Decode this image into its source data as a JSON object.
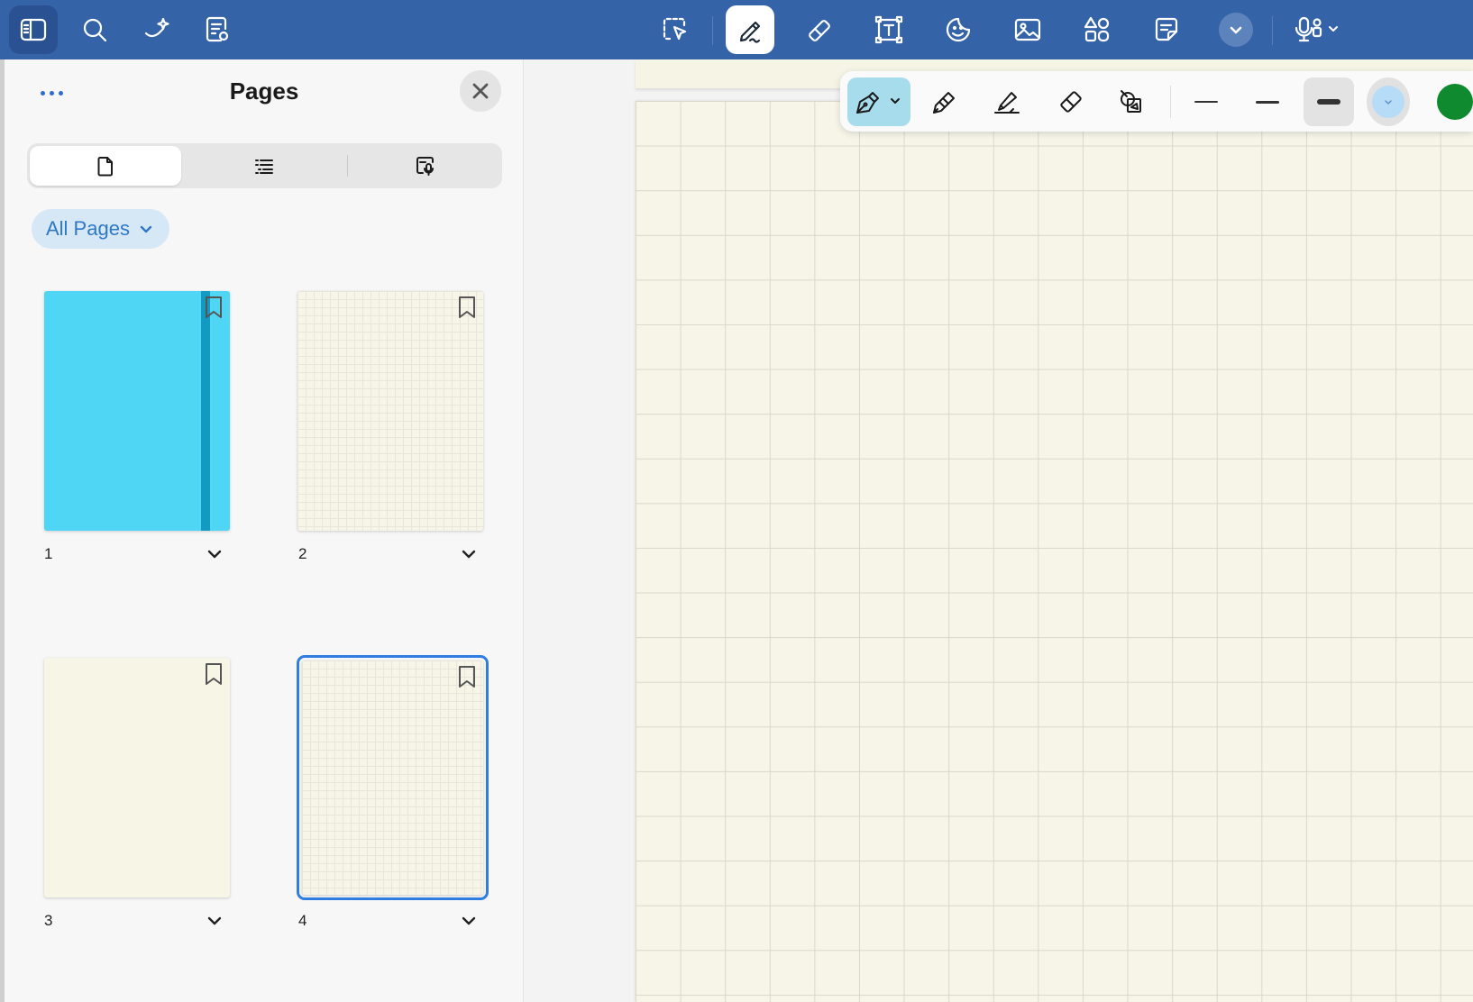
{
  "toolbar": {
    "left_tools": [
      "sidebar-toggle",
      "search",
      "ai-sparkle",
      "note-view"
    ],
    "center_tools": [
      "lasso-select",
      "pen",
      "eraser",
      "text-box",
      "sticker",
      "image",
      "shapes",
      "sticky-note",
      "more"
    ],
    "active_tool": "pen"
  },
  "sidebar": {
    "title": "Pages",
    "tabs": [
      "pages",
      "outline",
      "audio"
    ],
    "active_tab": "pages",
    "filter_label": "All Pages",
    "pages": [
      {
        "number": "1",
        "style": "cover",
        "cover_color": "#4fd6f4",
        "band_color": "#129ac2"
      },
      {
        "number": "2",
        "style": "grid-paper"
      },
      {
        "number": "3",
        "style": "plain-paper"
      },
      {
        "number": "4",
        "style": "grid-paper",
        "selected": true
      }
    ]
  },
  "pen_toolbar": {
    "tools": [
      "fountain-pen",
      "ball-pen",
      "highlighter",
      "eraser",
      "shape-tool"
    ],
    "active_tool": "fountain-pen",
    "widths": [
      "thin",
      "medium",
      "thick"
    ],
    "active_width": "thick",
    "colors": [
      {
        "name": "light-blue",
        "hex": "#b7dcf7"
      },
      {
        "name": "green",
        "hex": "#0f8a2e"
      }
    ]
  },
  "colors": {
    "toolbar_bg": "#3463a8",
    "accent": "#2f7de0",
    "paper": "#f6f5e8",
    "grid_line": "#d9d8ca"
  }
}
